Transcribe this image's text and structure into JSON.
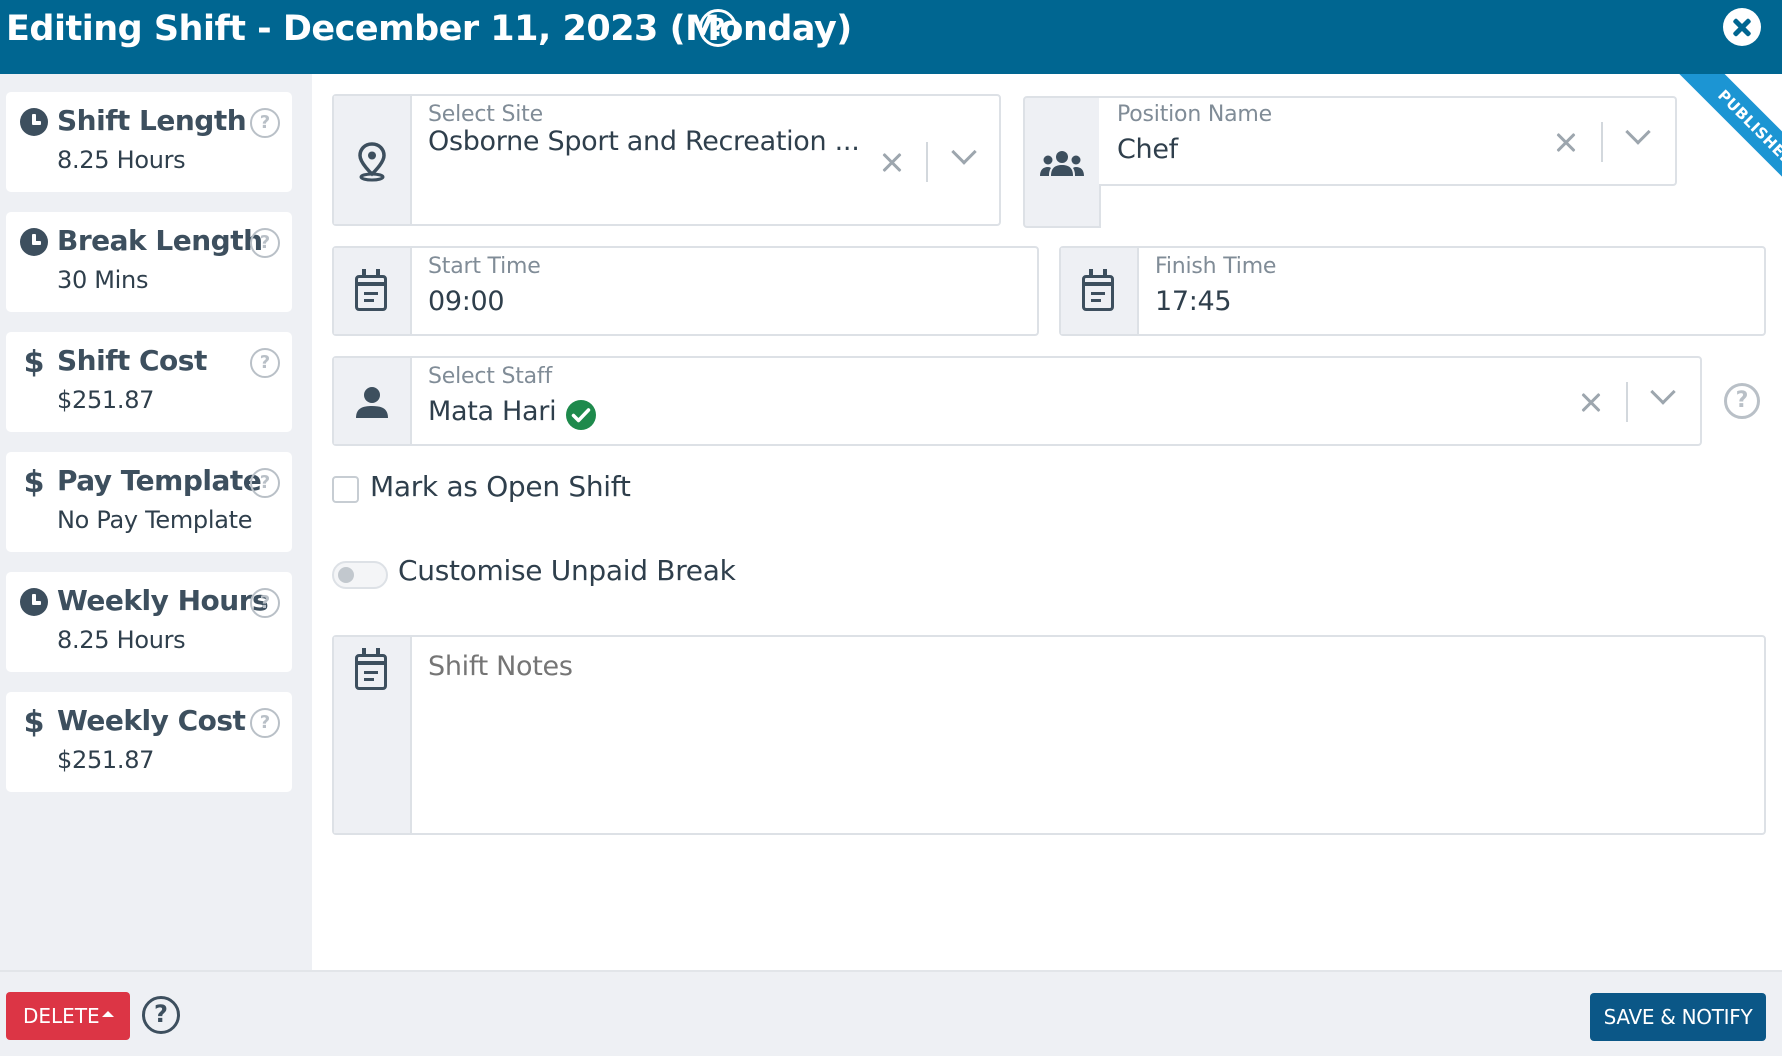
{
  "header": {
    "title": "Editing Shift - December 11, 2023 (Monday)",
    "help_symbol": "?"
  },
  "sidebar": {
    "stats": [
      {
        "label": "Shift Length",
        "value": "8.25 Hours",
        "icon": "clock-icon"
      },
      {
        "label": "Break Length",
        "value": "30 Mins",
        "icon": "clock-icon"
      },
      {
        "label": "Shift Cost",
        "value": "$251.87",
        "icon": "dollar-icon"
      },
      {
        "label": "Pay Template",
        "value": "No Pay Template",
        "icon": "dollar-icon"
      },
      {
        "label": "Weekly Hours",
        "value": "8.25 Hours",
        "icon": "clock-icon"
      },
      {
        "label": "Weekly Cost",
        "value": "$251.87",
        "icon": "dollar-icon"
      }
    ],
    "help_symbol": "?",
    "dollar_symbol": "$"
  },
  "form": {
    "site": {
      "label": "Select Site",
      "value": "Osborne Sport and Recreation ..."
    },
    "position": {
      "label": "Position Name",
      "value": "Chef"
    },
    "start_time": {
      "label": "Start Time",
      "value": "09:00"
    },
    "finish_time": {
      "label": "Finish Time",
      "value": "17:45"
    },
    "staff": {
      "label": "Select Staff",
      "value": "Mata Hari",
      "verified": true
    },
    "open_shift": {
      "label": "Mark as Open Shift",
      "checked": false
    },
    "unpaid_break": {
      "label": "Customise Unpaid Break",
      "enabled": false
    },
    "notes": {
      "placeholder": "Shift Notes",
      "value": ""
    }
  },
  "status_ribbon": "PUBLISHED",
  "footer": {
    "delete_label": "DELETE",
    "save_label": "SAVE & NOTIFY",
    "help_symbol": "?"
  },
  "colors": {
    "header_bg": "#006691",
    "delete": "#dc3545",
    "save": "#0b5787",
    "ribbon": "#1c95d3",
    "verified": "#1e8a4c"
  }
}
